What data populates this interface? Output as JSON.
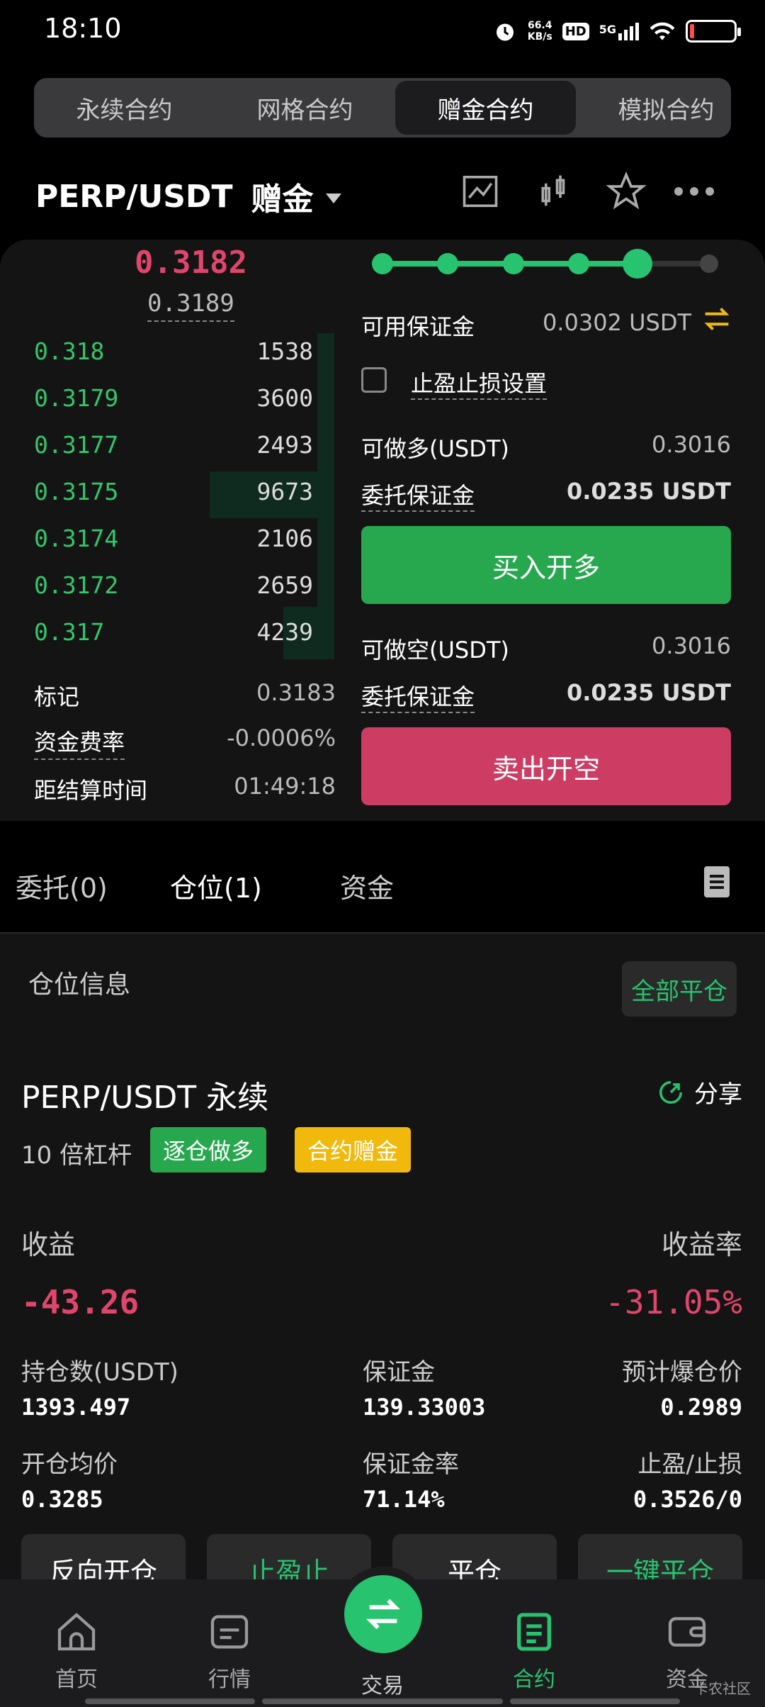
{
  "status_bar": {
    "time": "18:10",
    "net_speed": "66.4",
    "net_unit": "KB/s",
    "hd": "HD",
    "signal": "5G"
  },
  "top_tabs": [
    {
      "label": "永续合约"
    },
    {
      "label": "网格合约"
    },
    {
      "label": "赠金合约"
    },
    {
      "label": "模拟合约"
    }
  ],
  "pair_header": {
    "symbol": "PERP/USDT",
    "mode": "赠金"
  },
  "order_book": {
    "last_price": "0.3182",
    "mark_price": "0.3189",
    "rows": [
      {
        "price": "0.318",
        "qty": "1538"
      },
      {
        "price": "0.3179",
        "qty": "3600"
      },
      {
        "price": "0.3177",
        "qty": "2493"
      },
      {
        "price": "0.3175",
        "qty": "9673"
      },
      {
        "price": "0.3174",
        "qty": "2106"
      },
      {
        "price": "0.3172",
        "qty": "2659"
      },
      {
        "price": "0.317",
        "qty": "4239"
      }
    ],
    "mark_label": "标记",
    "mark_value": "0.3183",
    "funding_label": "资金费率",
    "funding_value": "-0.0006%",
    "settle_label": "距结算时间",
    "settle_value": "01:49:18"
  },
  "order_form": {
    "leverage_slider_level": 0.8,
    "available_margin_label": "可用保证金",
    "available_margin_value": "0.0302 USDT",
    "tpsl_label": "止盈止损设置",
    "long_available_label": "可做多(USDT)",
    "long_available_value": "0.3016",
    "long_margin_label": "委托保证金",
    "long_margin_value": "0.0235 USDT",
    "buy_button": "买入开多",
    "short_available_label": "可做空(USDT)",
    "short_available_value": "0.3016",
    "short_margin_label": "委托保证金",
    "short_margin_value": "0.0235 USDT",
    "sell_button": "卖出开空"
  },
  "bottom_tabs": [
    {
      "label": "委托(0)"
    },
    {
      "label": "仓位(1)"
    },
    {
      "label": "资金"
    }
  ],
  "position": {
    "section_title": "仓位信息",
    "close_all_button": "全部平仓",
    "symbol": "PERP/USDT 永续",
    "share": "分享",
    "leverage": "10 倍杠杆",
    "tag_side": "逐仓做多",
    "tag_bonus": "合约赠金",
    "pnl_label": "收益",
    "pnl_rate_label": "收益率",
    "pnl_value": "-43.26",
    "pnl_rate_value": "-31.05%",
    "size_label": "持仓数(USDT)",
    "size_value": "1393.497",
    "margin_label": "保证金",
    "margin_value": "139.33003",
    "liq_label": "预计爆仓价",
    "liq_value": "0.2989",
    "entry_label": "开仓均价",
    "entry_value": "0.3285",
    "margin_rate_label": "保证金率",
    "margin_rate_value": "71.14%",
    "tpsl_label": "止盈/止损",
    "tpsl_value": "0.3526/0",
    "actions": [
      "反向开仓",
      "止盈止",
      "平仓",
      "一键平仓"
    ]
  },
  "bottom_nav": [
    {
      "label": "首页"
    },
    {
      "label": "行情"
    },
    {
      "label": "交易"
    },
    {
      "label": "合约"
    },
    {
      "label": "资金"
    }
  ],
  "watermark": "卡农社区",
  "colors": {
    "green": "#27c36e",
    "red": "#e0456b",
    "buy": "#27a84f",
    "sell": "#cc3c63",
    "bonus": "#f0b90b"
  }
}
